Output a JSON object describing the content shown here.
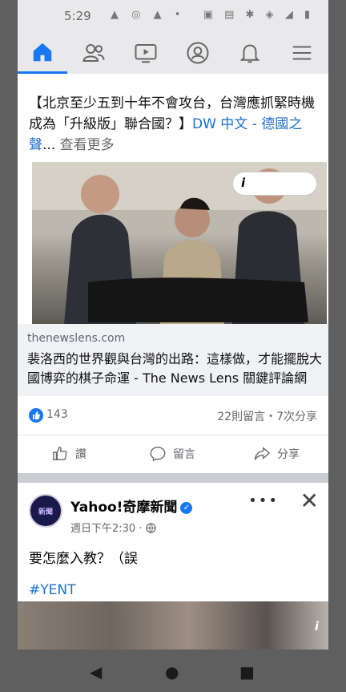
{
  "status_bar": {
    "time": "5:29",
    "left_icons": "▲ ◎ ▲ •",
    "right_icons": "▣ ▤ ✱ ◈ ◢ ▮"
  },
  "nav": {
    "items": [
      "home",
      "friends",
      "watch",
      "profile",
      "notifications",
      "menu"
    ],
    "accent": "#1877f2"
  },
  "post1": {
    "text_main": "【北京至少五到十年不會攻台，台灣應抓緊時機成為「升級版」聯合國？】",
    "text_link": "DW 中文 - 德國之聲",
    "text_ellipsis": "...",
    "see_more": "查看更多",
    "info_icon": "i",
    "link_domain": "thenewslens.com",
    "link_title": "裴洛西的世界觀與台灣的出路：這樣做，才能擺脫大國博弈的棋子命運 - The News Lens 關鍵評論網",
    "likes": "143",
    "comments_shares": "22則留言・7次分享",
    "action_like": "讚",
    "action_comment": "留言",
    "action_share": "分享"
  },
  "post2": {
    "avatar_text": "新聞",
    "page_name": "Yahoo!奇摩新聞",
    "verified_mark": "✓",
    "time": "週日下午2:30 · ",
    "more": "•••",
    "close": "✕",
    "text": "要怎麼入教？（誤",
    "hashtag": "#YENT",
    "info_icon": "i"
  },
  "system_nav": {
    "back": "◀",
    "home": "●",
    "recents": "■"
  }
}
